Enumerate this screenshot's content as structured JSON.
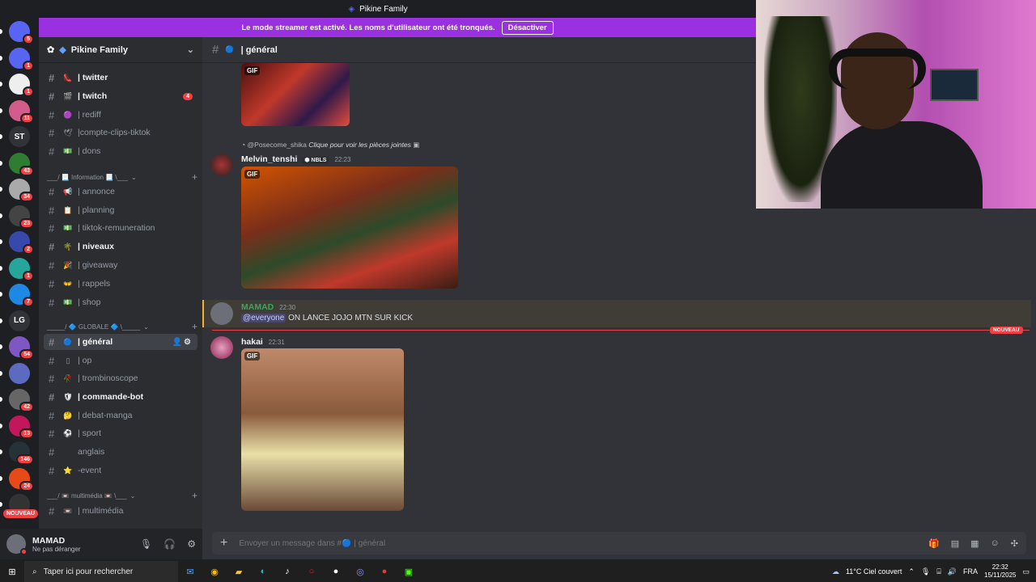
{
  "window": {
    "title": "Pikine Family"
  },
  "banner": {
    "message": "Le mode streamer est activé. Les noms d'utilisateur ont été tronqués.",
    "button": "Désactiver"
  },
  "servers": [
    {
      "label": "",
      "badge": "5"
    },
    {
      "label": "",
      "badge": "1"
    },
    {
      "label": "",
      "badge": "1"
    },
    {
      "label": "",
      "badge": "11"
    },
    {
      "label": "ST",
      "badge": ""
    },
    {
      "label": "",
      "badge": "43"
    },
    {
      "label": "",
      "badge": "34"
    },
    {
      "label": "",
      "badge": "23"
    },
    {
      "label": "",
      "badge": "2"
    },
    {
      "label": "",
      "badge": "1"
    },
    {
      "label": "",
      "badge": "7"
    },
    {
      "label": "LG",
      "badge": ""
    },
    {
      "label": "",
      "badge": "54"
    },
    {
      "label": "",
      "badge": ""
    },
    {
      "label": "",
      "badge": "42"
    },
    {
      "label": "",
      "badge": "13"
    },
    {
      "label": "",
      "badge": "146"
    },
    {
      "label": "",
      "badge": "24"
    },
    {
      "label": "",
      "badge": ""
    }
  ],
  "servers_new": "NOUVEAU",
  "sidebar": {
    "server_name": "Pikine Family",
    "channels": [
      {
        "name": "| twitter",
        "emoji": "👠",
        "state": "unread",
        "badge": ""
      },
      {
        "name": "| twitch",
        "emoji": "🎬",
        "state": "unread",
        "badge": "4"
      },
      {
        "name": "| rediff",
        "emoji": "🟣",
        "state": "",
        "badge": ""
      },
      {
        "name": "|compte-clips-tiktok",
        "emoji": "🕊",
        "state": "",
        "badge": ""
      },
      {
        "name": "| dons",
        "emoji": "💵",
        "state": "",
        "badge": ""
      },
      {
        "name": "| annonce",
        "emoji": "📢",
        "state": "",
        "badge": ""
      },
      {
        "name": "| planning",
        "emoji": "📋",
        "state": "",
        "badge": ""
      },
      {
        "name": "| tiktok-remuneration",
        "emoji": "💵",
        "state": "",
        "badge": ""
      },
      {
        "name": "| niveaux",
        "emoji": "🌴",
        "state": "unread",
        "badge": ""
      },
      {
        "name": "| giveaway",
        "emoji": "🎉",
        "state": "",
        "badge": ""
      },
      {
        "name": "| rappels",
        "emoji": "👐",
        "state": "",
        "badge": ""
      },
      {
        "name": "| shop",
        "emoji": "💵",
        "state": "",
        "badge": ""
      },
      {
        "name": "| général",
        "emoji": "🔵",
        "state": "active",
        "badge": ""
      },
      {
        "name": "| op",
        "emoji": "▯",
        "state": "",
        "badge": ""
      },
      {
        "name": "| trombinoscope",
        "emoji": "🥀",
        "state": "",
        "badge": ""
      },
      {
        "name": "| commande-bot",
        "emoji": "🛡",
        "state": "unread",
        "badge": ""
      },
      {
        "name": "| debat-manga",
        "emoji": "🤔",
        "state": "",
        "badge": ""
      },
      {
        "name": "| sport",
        "emoji": "⚽",
        "state": "",
        "badge": ""
      },
      {
        "name": "anglais",
        "emoji": "",
        "state": "",
        "badge": ""
      },
      {
        "name": "-event",
        "emoji": "⭐",
        "state": "",
        "badge": ""
      },
      {
        "name": "| multimédia",
        "emoji": "📼",
        "state": "",
        "badge": ""
      }
    ],
    "categories": [
      "___/ 📃 Information 📃 \\___",
      "_____/ 🔷 GLOBALE 🔷 \\_____",
      "___/ 📼 multimédia 📼 \\___"
    ]
  },
  "user": {
    "name": "MAMAD",
    "status": "Ne pas déranger"
  },
  "channel": {
    "name": "| général",
    "emoji": "🔵"
  },
  "messages": [
    {
      "reply": "@Posecome_shika",
      "reply_text": "Clique pour voir les pièces jointes",
      "author": "Melvin_tenshi",
      "tag": "NBLS",
      "time": "22:23",
      "gif": "GIF"
    },
    {
      "author": "MAMAD",
      "time": "22:30",
      "mention": "@everyone",
      "text": "ON LANCE JOJO MTN SUR KICK"
    },
    {
      "author": "hakai",
      "time": "22:31",
      "gif": "GIF"
    }
  ],
  "top_gif": "GIF",
  "new_label": "NOUVEAU",
  "composer": {
    "placeholder": "Envoyer un message dans #🔵 | général"
  },
  "taskbar": {
    "search": "Taper ici pour rechercher",
    "weather": "11°C  Ciel couvert",
    "lang": "FRA",
    "time": "22:32",
    "date": "15/11/2025"
  },
  "colors": {
    "accent": "#5865f2",
    "streamer_banner": "#9b30e0",
    "mention_red": "#f23f43",
    "green_name": "#3ba55c"
  }
}
